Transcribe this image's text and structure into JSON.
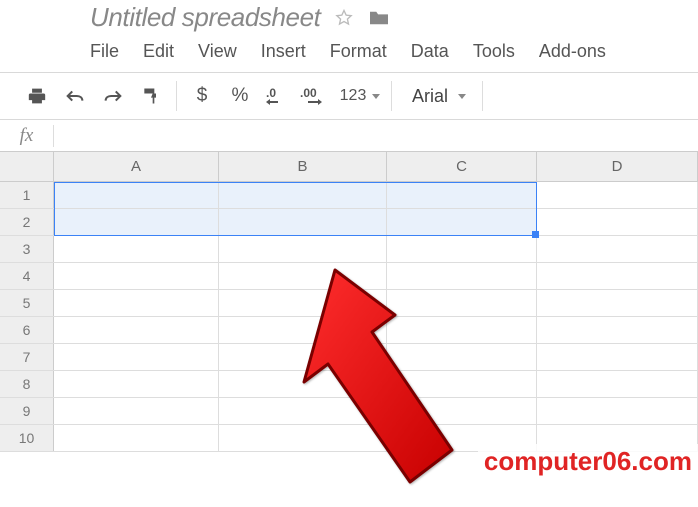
{
  "doc": {
    "title": "Untitled spreadsheet"
  },
  "menu": {
    "file": "File",
    "edit": "Edit",
    "view": "View",
    "insert": "Insert",
    "format": "Format",
    "data": "Data",
    "tools": "Tools",
    "addons": "Add-ons"
  },
  "toolbar": {
    "currency": "$",
    "percent": "%",
    "dec_dec": ".0",
    "inc_dec": ".00",
    "numfmt": "123",
    "font": "Arial"
  },
  "fx": {
    "label": "fx",
    "value": ""
  },
  "grid": {
    "cols": [
      "A",
      "B",
      "C",
      "D"
    ],
    "rows": [
      "1",
      "2",
      "3",
      "4",
      "5",
      "6",
      "7",
      "8",
      "9",
      "10"
    ],
    "selection": "A1:C2"
  },
  "watermark": "computer06.com"
}
